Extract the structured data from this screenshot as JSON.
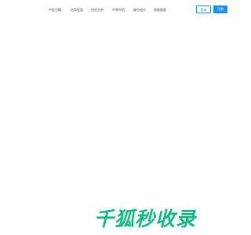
{
  "nav": {
    "items": [
      {
        "label": "中医古籍"
      },
      {
        "label": "名家医案"
      },
      {
        "label": "经验方剂"
      },
      {
        "label": "中草中药"
      },
      {
        "label": "偏方秘方"
      },
      {
        "label": "智能搜索"
      }
    ]
  },
  "auth": {
    "login_label": "登录",
    "register_label": "注册"
  },
  "brand": {
    "text": "千狐秒收录"
  },
  "colors": {
    "accent": "#1f8ef1",
    "brand": "#10b87f",
    "nav_text": "#4c4c4c",
    "background": "#ffffff"
  }
}
